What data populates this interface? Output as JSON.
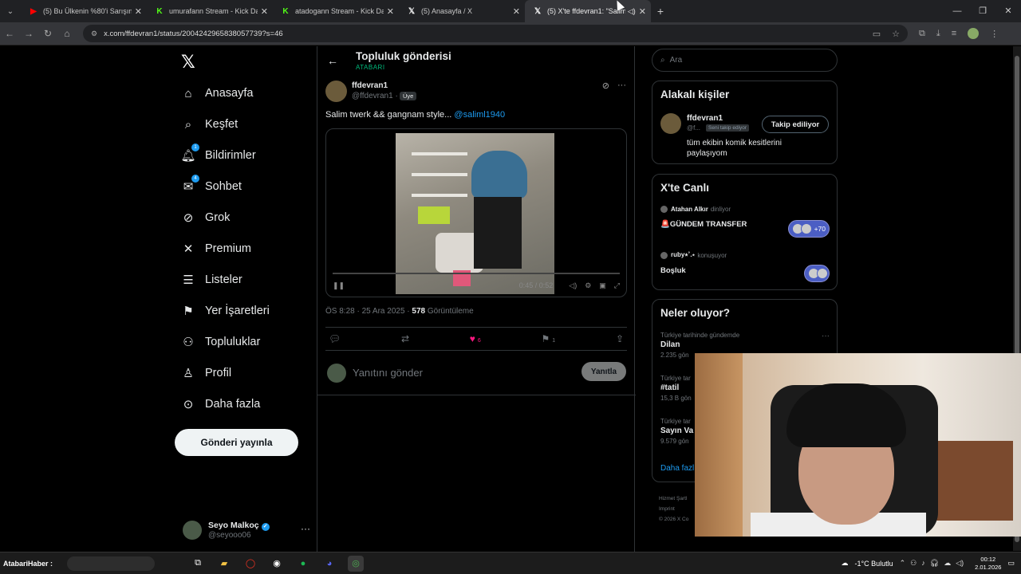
{
  "browser": {
    "tabs": [
      {
        "label": "(5) Bu Ülkenin %80'i Sarışın! - A",
        "favicon": "youtube-icon",
        "color": "#ff0000",
        "glyph": "▶"
      },
      {
        "label": "umurafann Stream - Kick Dashb",
        "favicon": "kick-icon",
        "color": "#53fc18",
        "glyph": "K"
      },
      {
        "label": "atadogann Stream - Kick Dashb",
        "favicon": "kick-icon",
        "color": "#53fc18",
        "glyph": "K"
      },
      {
        "label": "(5) Anasayfa / X",
        "favicon": "x-icon",
        "color": "#ffffff",
        "glyph": "𝕏"
      },
      {
        "label": "(5) X'te ffdevran1: \"Salim t",
        "favicon": "x-icon",
        "color": "#ffffff",
        "glyph": "𝕏",
        "active": true
      }
    ],
    "url": "x.com/ffdevran1/status/2004242965838057739?s=46"
  },
  "leftnav": {
    "items": [
      {
        "label": "Anasayfa",
        "icon": "home-icon",
        "glyph": "⌂"
      },
      {
        "label": "Keşfet",
        "icon": "search-icon",
        "glyph": "⌕"
      },
      {
        "label": "Bildirimler",
        "icon": "bell-icon",
        "glyph": "🔔︎",
        "badge": "1"
      },
      {
        "label": "Sohbet",
        "icon": "mail-icon",
        "glyph": "✉",
        "badge": "4"
      },
      {
        "label": "Grok",
        "icon": "grok-icon",
        "glyph": "⊘"
      },
      {
        "label": "Premium",
        "icon": "x-premium-icon",
        "glyph": "✕"
      },
      {
        "label": "Listeler",
        "icon": "list-icon",
        "glyph": "☰"
      },
      {
        "label": "Yer İşaretleri",
        "icon": "bookmark-icon",
        "glyph": "⚑"
      },
      {
        "label": "Topluluklar",
        "icon": "communities-icon",
        "glyph": "⚇"
      },
      {
        "label": "Profil",
        "icon": "person-icon",
        "glyph": "♙"
      },
      {
        "label": "Daha fazla",
        "icon": "more-circle-icon",
        "glyph": "⊙"
      }
    ],
    "post_button": "Gönderi yayınla",
    "account": {
      "name": "Seyo Malkoç",
      "handle": "@seyooo06"
    }
  },
  "main": {
    "title": "Topluluk gönderisi",
    "subtitle": "ATABARI",
    "post": {
      "author": "ffdevran1",
      "handle": "@ffdevran1 ·",
      "tag": "Üye",
      "text": "Salim twerk && gangnam style... ",
      "mention": "@saliml1940",
      "video_time": "0:45 / 0:52",
      "time": "ÖS 8:28 · 25 Ara 2025 · ",
      "views_count": "578",
      "views_label": " Görüntüleme",
      "likes": "6",
      "bookmarks": "1"
    },
    "reply": {
      "placeholder": "Yanıtını gönder",
      "button": "Yanıtla"
    }
  },
  "right": {
    "search_placeholder": "Ara",
    "related": {
      "title": "Alakalı kişiler",
      "name": "ffdevran1",
      "handle": "@f...",
      "tag": "Seni takip ediyor",
      "button": "Takip ediliyor",
      "bio": "tüm ekibin komik kesitlerini paylaşıyom"
    },
    "live": {
      "title": "X'te Canlı",
      "items": [
        {
          "host": "Atahan Alkır",
          "status": "dinliyor",
          "title": "🚨GÜNDEM TRANSFER",
          "count": "+70"
        },
        {
          "host": "ruby⭑˚.⋆",
          "status": "konuşuyor",
          "title": "Boşluk",
          "count": ""
        }
      ]
    },
    "trends": {
      "title": "Neler oluyor?",
      "items": [
        {
          "context": "Türkiye tarihinde gündemde",
          "topic": "Dilan",
          "count": "2.235 gön"
        },
        {
          "context": "Türkiye tar",
          "topic": "#tatil",
          "count": "15,3 B gön"
        },
        {
          "context": "Türkiye tar",
          "topic": "Sayın Va",
          "count": "9.579 gön"
        }
      ],
      "show_more": "Daha fazl"
    },
    "footer": [
      "Hizmet Şartl",
      "Imprint",
      "© 2026 X Co"
    ]
  },
  "taskbar": {
    "label": "AtabariHaber :",
    "weather": "-1°C  Bulutlu",
    "time": "00:12",
    "date": "2.01.2026"
  }
}
